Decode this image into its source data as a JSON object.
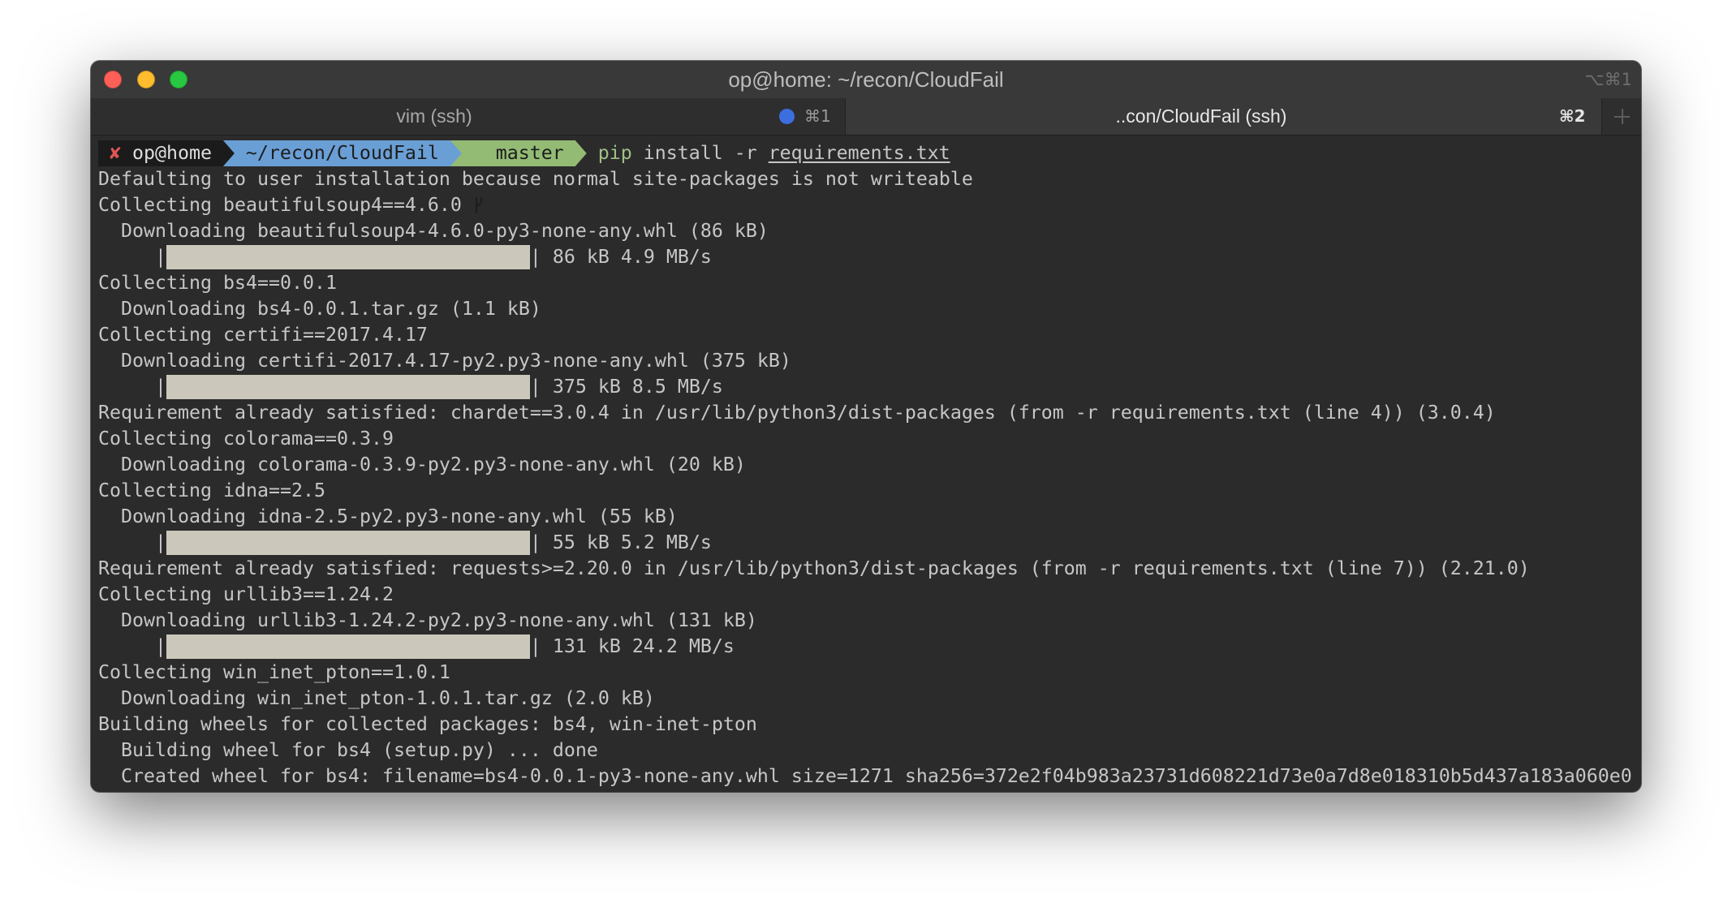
{
  "window": {
    "title": "op@home: ~/recon/CloudFail",
    "shortcut": "⌥⌘1"
  },
  "tabs": [
    {
      "label": "vim (ssh)",
      "shortcut": "⌘1",
      "active": false,
      "has_activity": true
    },
    {
      "label": "..con/CloudFail (ssh)",
      "shortcut": "⌘2",
      "active": true,
      "has_activity": false
    }
  ],
  "icons": {
    "new_tab": "plus-icon",
    "branch": "git-branch-icon",
    "activity": "activity-dot-icon"
  },
  "prompt": {
    "status_symbol": "✘",
    "user_host": "op@home",
    "path": "~/recon/CloudFail",
    "branch": "master",
    "command": "pip",
    "args": "install -r",
    "file_arg": "requirements.txt"
  },
  "terminal": {
    "lines": [
      {
        "text": "Defaulting to user installation because normal site-packages is not writeable"
      },
      {
        "text": "Collecting beautifulsoup4==4.6.0"
      },
      {
        "text": "  Downloading beautifulsoup4-4.6.0-py3-none-any.whl (86 kB)"
      },
      {
        "prefix": "     |",
        "progress": 1,
        "suffix": "| 86 kB 4.9 MB/s"
      },
      {
        "text": "Collecting bs4==0.0.1"
      },
      {
        "text": "  Downloading bs4-0.0.1.tar.gz (1.1 kB)"
      },
      {
        "text": "Collecting certifi==2017.4.17"
      },
      {
        "text": "  Downloading certifi-2017.4.17-py2.py3-none-any.whl (375 kB)"
      },
      {
        "prefix": "     |",
        "progress": 1,
        "suffix": "| 375 kB 8.5 MB/s"
      },
      {
        "text": "Requirement already satisfied: chardet==3.0.4 in /usr/lib/python3/dist-packages (from -r requirements.txt (line 4)) (3.0.4)"
      },
      {
        "text": "Collecting colorama==0.3.9"
      },
      {
        "text": "  Downloading colorama-0.3.9-py2.py3-none-any.whl (20 kB)"
      },
      {
        "text": "Collecting idna==2.5"
      },
      {
        "text": "  Downloading idna-2.5-py2.py3-none-any.whl (55 kB)"
      },
      {
        "prefix": "     |",
        "progress": 1,
        "suffix": "| 55 kB 5.2 MB/s"
      },
      {
        "text": "Requirement already satisfied: requests>=2.20.0 in /usr/lib/python3/dist-packages (from -r requirements.txt (line 7)) (2.21.0)"
      },
      {
        "text": "Collecting urllib3==1.24.2"
      },
      {
        "text": "  Downloading urllib3-1.24.2-py2.py3-none-any.whl (131 kB)"
      },
      {
        "prefix": "     |",
        "progress": 1,
        "suffix": "| 131 kB 24.2 MB/s"
      },
      {
        "text": "Collecting win_inet_pton==1.0.1"
      },
      {
        "text": "  Downloading win_inet_pton-1.0.1.tar.gz (2.0 kB)"
      },
      {
        "text": "Building wheels for collected packages: bs4, win-inet-pton"
      },
      {
        "text": "  Building wheel for bs4 (setup.py) ... done"
      },
      {
        "text": "  Created wheel for bs4: filename=bs4-0.0.1-py3-none-any.whl size=1271 sha256=372e2f04b983a23731d608221d73e0a7d8e018310b5d437a183a060e0"
      }
    ]
  },
  "colors": {
    "terminal_background": "#2b2b2b",
    "terminal_text": "#c6c6c6",
    "titlebar_background": "#393939",
    "title_text": "#bdbdbd",
    "tab_active_background": "#393939",
    "tab_inactive_background": "#2e2e2e",
    "tab_active_text": "#e8e8e8",
    "tab_inactive_text": "#a8a8a8",
    "close_button": "#fe5f57",
    "minimize_button": "#febc2e",
    "maximize_button": "#28c840",
    "activity_dot": "#3c6ee0",
    "prompt_user_segment": "#1b1b1b",
    "prompt_status_symbol": "#e05555",
    "prompt_user_text": "#dedede",
    "prompt_path_segment": "#6a9fd6",
    "prompt_branch_segment": "#93bb74",
    "prompt_segment_text": "#1d1d1d",
    "command_highlight": "#9fc085",
    "progress_bar": "#cbc8bb"
  }
}
